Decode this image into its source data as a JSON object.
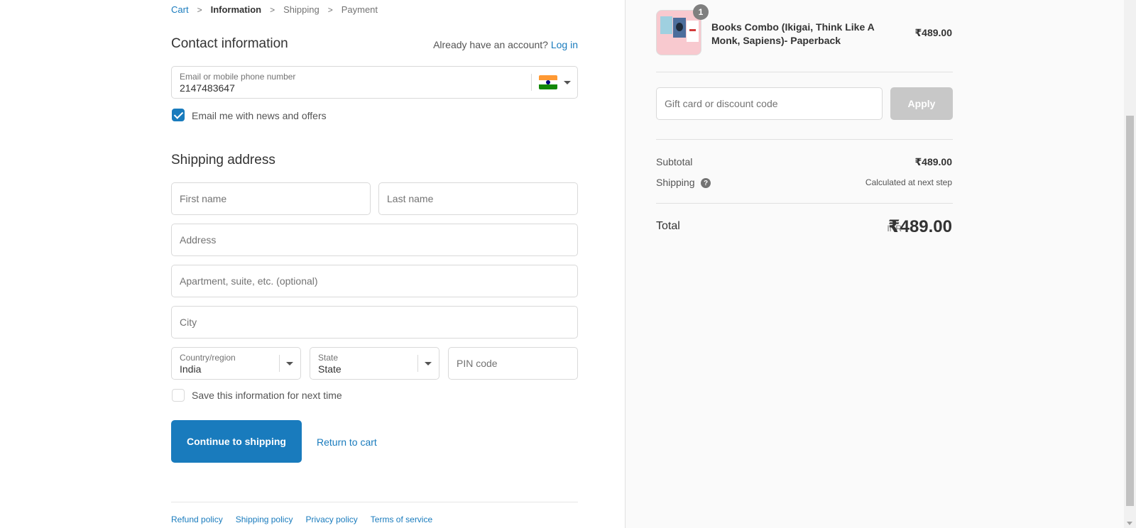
{
  "breadcrumb": {
    "cart": "Cart",
    "information": "Information",
    "shipping": "Shipping",
    "payment": "Payment",
    "separator": ">"
  },
  "contact": {
    "title": "Contact information",
    "account_prompt": "Already have an account?",
    "login": "Log in",
    "email_label": "Email or mobile phone number",
    "email_value": "2147483647",
    "newsletter_label": "Email me with news and offers",
    "newsletter_checked": true
  },
  "shipping": {
    "title": "Shipping address",
    "first_name_ph": "First name",
    "last_name_ph": "Last name",
    "address_ph": "Address",
    "apartment_ph": "Apartment, suite, etc. (optional)",
    "city_ph": "City",
    "country_label": "Country/region",
    "country_value": "India",
    "state_label": "State",
    "state_value": "State",
    "pin_ph": "PIN code",
    "save_label": "Save this information for next time",
    "save_checked": false
  },
  "actions": {
    "continue": "Continue to shipping",
    "return": "Return to cart"
  },
  "footer": {
    "refund": "Refund policy",
    "shipping": "Shipping policy",
    "privacy": "Privacy policy",
    "terms": "Terms of service"
  },
  "summary": {
    "product_name": "Books Combo (Ikigai, Think Like A Monk, Sapiens)- Paperback",
    "product_price": "₹489.00",
    "quantity": "1",
    "discount_ph": "Gift card or discount code",
    "apply": "Apply",
    "subtotal_label": "Subtotal",
    "subtotal_value": "₹489.00",
    "shipping_label": "Shipping",
    "shipping_value": "Calculated at next step",
    "total_label": "Total",
    "currency": "INR",
    "total_value": "₹489.00"
  },
  "colors": {
    "accent": "#197bbd",
    "apply_disabled": "#c8c8c8",
    "sidebar_bg": "#fafafa"
  }
}
